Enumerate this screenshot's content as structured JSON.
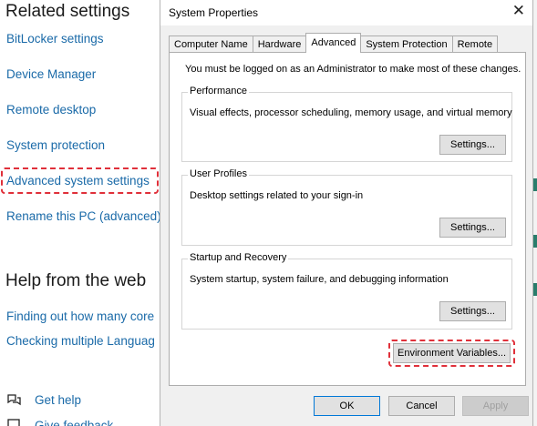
{
  "left_panel": {
    "related_heading": "Related settings",
    "links": [
      "BitLocker settings",
      "Device Manager",
      "Remote desktop",
      "System protection",
      "Advanced system settings",
      "Rename this PC (advanced)"
    ],
    "help_heading": "Help from the web",
    "web_links": [
      "Finding out how many core",
      "Checking multiple Languag"
    ],
    "get_help": "Get help",
    "give_feedback": "Give feedback"
  },
  "dialog": {
    "title": "System Properties",
    "close_glyph": "✕",
    "tabs": [
      "Computer Name",
      "Hardware",
      "Advanced",
      "System Protection",
      "Remote"
    ],
    "active_tab": "Advanced",
    "admin_note": "You must be logged on as an Administrator to make most of these changes.",
    "groups": {
      "performance": {
        "label": "Performance",
        "description": "Visual effects, processor scheduling, memory usage, and virtual memory",
        "button": "Settings..."
      },
      "user_profiles": {
        "label": "User Profiles",
        "description": "Desktop settings related to your sign-in",
        "button": "Settings..."
      },
      "startup_recovery": {
        "label": "Startup and Recovery",
        "description": "System startup, system failure, and debugging information",
        "button": "Settings..."
      }
    },
    "env_button": "Environment Variables...",
    "ok": "OK",
    "cancel": "Cancel",
    "apply": "Apply"
  },
  "colors": {
    "link": "#1a6aa8",
    "highlight": "#e0303a",
    "ok_border": "#0078d7"
  },
  "icons": {
    "get_help": "help-chat-icon",
    "feedback": "feedback-icon"
  }
}
